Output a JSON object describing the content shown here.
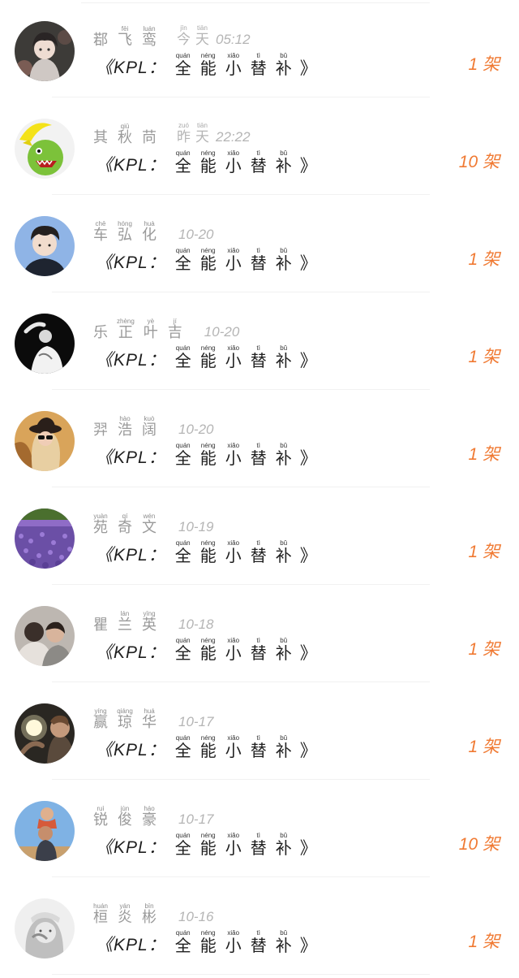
{
  "title_prefix": "《KPL：",
  "title_chars": [
    {
      "py": "quán",
      "hz": "全"
    },
    {
      "py": "néng",
      "hz": "能"
    },
    {
      "py": "xiǎo",
      "hz": "小"
    },
    {
      "py": "tì",
      "hz": "替"
    },
    {
      "py": "bǔ",
      "hz": "补"
    }
  ],
  "title_suffix": "》",
  "rows": [
    {
      "name": [
        {
          "py": "",
          "hz": "鄀"
        },
        {
          "py": "fēi",
          "hz": "飞"
        },
        {
          "py": "luán",
          "hz": "鸾"
        }
      ],
      "time_words": [
        {
          "py": "jīn",
          "hz": "今"
        },
        {
          "py": "tiān",
          "hz": "天"
        }
      ],
      "time": "05:12",
      "count": "1 架"
    },
    {
      "name": [
        {
          "py": "",
          "hz": "其"
        },
        {
          "py": "qiū",
          "hz": "秋"
        },
        {
          "py": "",
          "hz": "苘"
        }
      ],
      "time_words": [
        {
          "py": "zuó",
          "hz": "昨"
        },
        {
          "py": "tiān",
          "hz": "天"
        }
      ],
      "time": "22:22",
      "count": "10 架"
    },
    {
      "name": [
        {
          "py": "chē",
          "hz": "车"
        },
        {
          "py": "hóng",
          "hz": "弘"
        },
        {
          "py": "huà",
          "hz": "化"
        }
      ],
      "time_words": [],
      "time": "10-20",
      "count": "1 架"
    },
    {
      "name": [
        {
          "py": "",
          "hz": "乐"
        },
        {
          "py": "zhèng",
          "hz": "正"
        },
        {
          "py": "yè",
          "hz": "叶"
        },
        {
          "py": "jí",
          "hz": "吉"
        }
      ],
      "time_words": [],
      "time": "10-20",
      "count": "1 架"
    },
    {
      "name": [
        {
          "py": "",
          "hz": "羿"
        },
        {
          "py": "hào",
          "hz": "浩"
        },
        {
          "py": "kuò",
          "hz": "阔"
        }
      ],
      "time_words": [],
      "time": "10-20",
      "count": "1 架"
    },
    {
      "name": [
        {
          "py": "yuàn",
          "hz": "苑"
        },
        {
          "py": "qí",
          "hz": "奇"
        },
        {
          "py": "wén",
          "hz": "文"
        }
      ],
      "time_words": [],
      "time": "10-19",
      "count": "1 架"
    },
    {
      "name": [
        {
          "py": "",
          "hz": "瞿"
        },
        {
          "py": "lán",
          "hz": "兰"
        },
        {
          "py": "yīng",
          "hz": "英"
        }
      ],
      "time_words": [],
      "time": "10-18",
      "count": "1 架"
    },
    {
      "name": [
        {
          "py": "yíng",
          "hz": "赢"
        },
        {
          "py": "qiáng",
          "hz": "琼"
        },
        {
          "py": "huá",
          "hz": "华"
        }
      ],
      "time_words": [],
      "time": "10-17",
      "count": "1 架"
    },
    {
      "name": [
        {
          "py": "ruì",
          "hz": "锐"
        },
        {
          "py": "jùn",
          "hz": "俊"
        },
        {
          "py": "háo",
          "hz": "豪"
        }
      ],
      "time_words": [],
      "time": "10-17",
      "count": "10 架"
    },
    {
      "name": [
        {
          "py": "huán",
          "hz": "桓"
        },
        {
          "py": "yán",
          "hz": "炎"
        },
        {
          "py": "bīn",
          "hz": "彬"
        }
      ],
      "time_words": [],
      "time": "10-16",
      "count": "1 架"
    }
  ]
}
